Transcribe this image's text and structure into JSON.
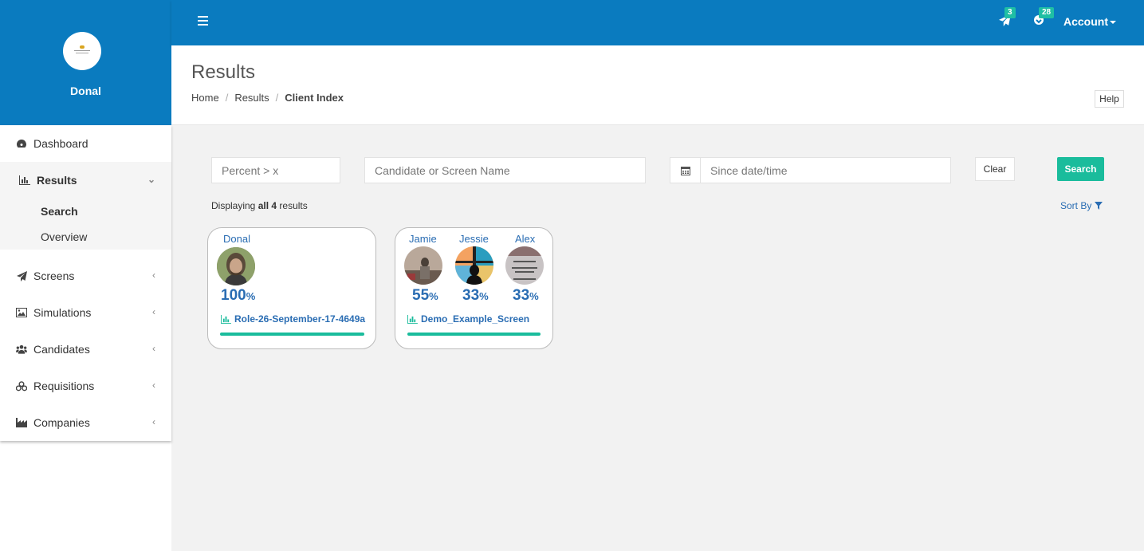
{
  "sidebar": {
    "user_name": "Donal",
    "menu": {
      "dashboard": "Dashboard",
      "results": "Results",
      "results_sub": {
        "search": "Search",
        "overview": "Overview"
      },
      "screens": "Screens",
      "simulations": "Simulations",
      "candidates": "Candidates",
      "requisitions": "Requisitions",
      "companies": "Companies"
    }
  },
  "topbar": {
    "messages_count": "3",
    "alerts_count": "28",
    "account_label": "Account"
  },
  "header": {
    "title": "Results",
    "breadcrumb": {
      "home": "Home",
      "results": "Results",
      "current": "Client Index"
    },
    "help_label": "Help"
  },
  "filters": {
    "percent_placeholder": "Percent > x",
    "name_placeholder": "Candidate or Screen Name",
    "date_placeholder": "Since date/time",
    "clear_label": "Clear",
    "search_label": "Search"
  },
  "summary": {
    "prefix": "Displaying",
    "all": "all 4",
    "suffix": "results",
    "sort_label": "Sort By"
  },
  "cards": [
    {
      "screen": "Role-26-September-17-4649a",
      "candidates": [
        {
          "name": "Donal",
          "percent": "100",
          "unit": "%"
        }
      ]
    },
    {
      "screen": "Demo_Example_Screen",
      "candidates": [
        {
          "name": "Jamie",
          "percent": "55",
          "unit": "%"
        },
        {
          "name": "Jessie",
          "percent": "33",
          "unit": "%"
        },
        {
          "name": "Alex",
          "percent": "33",
          "unit": "%"
        }
      ]
    }
  ],
  "colors": {
    "primary": "#0a7bbf",
    "accent": "#1abc9c",
    "link": "#2a6db3"
  }
}
